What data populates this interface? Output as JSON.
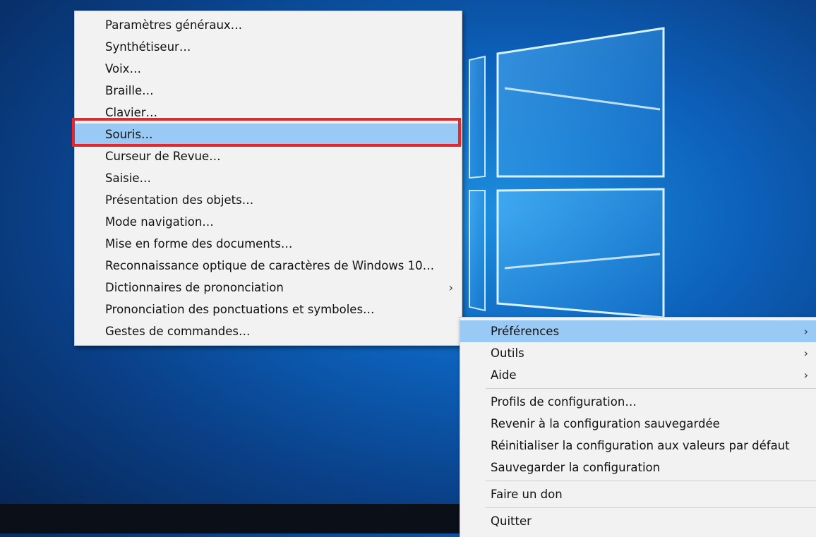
{
  "desktop": {
    "accent": "#0c5fb8",
    "logo_color": "#8fd3ff"
  },
  "preferences_submenu": {
    "items": [
      {
        "label": "Paramètres généraux…"
      },
      {
        "label": "Synthétiseur…"
      },
      {
        "label": "Voix…"
      },
      {
        "label": "Braille…"
      },
      {
        "label": "Clavier…"
      },
      {
        "label": "Souris…",
        "highlighted": true
      },
      {
        "label": "Curseur de Revue…"
      },
      {
        "label": "Saisie…"
      },
      {
        "label": "Présentation des objets…"
      },
      {
        "label": "Mode navigation…"
      },
      {
        "label": "Mise en forme des documents…"
      },
      {
        "label": "Reconnaissance optique de caractères de Windows 10…"
      },
      {
        "label": "Dictionnaires de prononciation",
        "submenu_arrow": "›"
      },
      {
        "label": "Prononciation des ponctuations et symboles…"
      },
      {
        "label": "Gestes de commandes…"
      }
    ],
    "highlight_color": "#99c9f5",
    "focus_outline_color": "#e8262d"
  },
  "main_menu": {
    "items": [
      {
        "label": "Préférences",
        "submenu_arrow": "›",
        "highlighted": true
      },
      {
        "label": "Outils",
        "submenu_arrow": "›"
      },
      {
        "label": "Aide",
        "submenu_arrow": "›"
      },
      {
        "label": "Profils de configuration…"
      },
      {
        "label": "Revenir à la configuration sauvegardée"
      },
      {
        "label": "Réinitialiser la configuration aux valeurs par défaut"
      },
      {
        "label": "Sauvegarder la configuration"
      },
      {
        "label": "Faire un don"
      },
      {
        "label": "Quitter"
      }
    ]
  }
}
